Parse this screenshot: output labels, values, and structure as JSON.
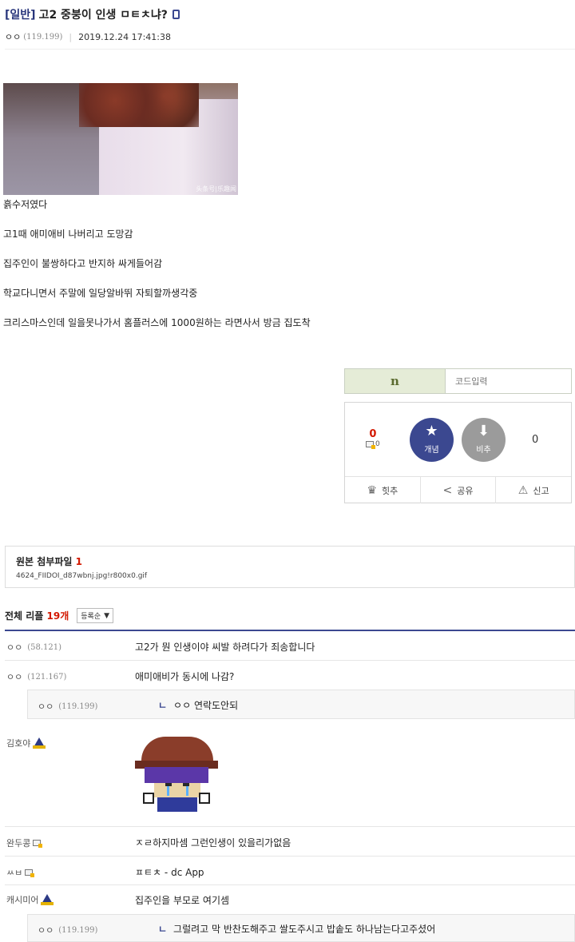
{
  "post": {
    "head": "[일반]",
    "title": "고2 중붕이 인생 ㅁㅌㅊ냐?",
    "author": "ㅇㅇ",
    "author_ip": "(119.199)",
    "date": "2019.12.24 17:41:38",
    "image_watermark": "头条号|乐趣闻",
    "body_lines": [
      "흙수저였다",
      "고1때 애미애비 나버리고 도망감",
      "집주인이 불쌍하다고 반지하 싸게들어감",
      "학교다니면서 주말에 일당알바뛰 자퇴할까생각중",
      "크리스마스인데 일을못나가서 홈플러스에 1000원하는 라면사서 방금 집도착"
    ]
  },
  "recommend": {
    "captcha_text": "n",
    "code_placeholder": "코드입력",
    "up_count": "0",
    "fix_count": "0",
    "up_label": "개념",
    "down_label": "비추",
    "down_count": "0",
    "actions": [
      "힛추",
      "공유",
      "신고"
    ]
  },
  "attachments": {
    "label": "원본 첨부파일",
    "count": "1",
    "file": "4624_FIIDOI_d87wbnj.jpg!r800x0.gif"
  },
  "comments_header": {
    "title": "전체 리플",
    "count": "19개",
    "sort": "등록순"
  },
  "comments": [
    {
      "nick": "ㅇㅇ",
      "ip": "(58.121)",
      "text": "고2가 뭔 인생이야 씨발 하려다가 죄송합니다"
    },
    {
      "nick": "ㅇㅇ",
      "ip": "(121.167)",
      "text": "애미애비가 동시에 나감?"
    },
    {
      "nick": "ㅇㅇ",
      "ip": "(119.199)",
      "text": "ㅇㅇ 연락도안되"
    },
    {
      "nick": "김호야",
      "ip": "",
      "text": ""
    },
    {
      "nick": "완두콩",
      "ip": "",
      "text": "ㅈㄹ하지마셈 그런인생이 있을리가없음"
    },
    {
      "nick": "ㅆㅂ",
      "ip": "",
      "text": "ㅍㅌㅊ - dc App"
    },
    {
      "nick": "캐시미어",
      "ip": "",
      "text": "집주인을 부모로 여기셈"
    },
    {
      "nick": "ㅇㅇ",
      "ip": "(119.199)",
      "text": "그럴려고 막 반찬도해주고 쌀도주시고 밥솥도 하나남는다고주셨어"
    }
  ],
  "reply_mark": "ㄴ",
  "colors": {
    "accent": "#3b4890",
    "count_red": "#d31900"
  }
}
